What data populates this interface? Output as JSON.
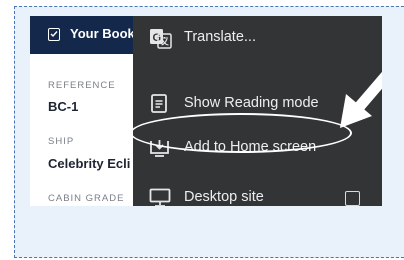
{
  "header": {
    "title": "Your Book",
    "icon": "calendar-check-icon",
    "background": "#14284b"
  },
  "fields": [
    {
      "label": "REFERENCE",
      "value": "BC-1"
    },
    {
      "label": "SHIP",
      "value": "Celebrity Ecli"
    },
    {
      "label": "CABIN GRADE",
      "value": ""
    }
  ],
  "menu": {
    "background": "#333436",
    "items": [
      {
        "label": "Translate...",
        "icon": "google-translate-icon"
      },
      {
        "label": "Show Reading mode",
        "icon": "reading-mode-icon"
      },
      {
        "label": "Add to Home screen",
        "icon": "add-to-home-screen-icon",
        "highlighted": true
      },
      {
        "label": "Desktop site",
        "icon": "desktop-icon",
        "checkbox": false
      }
    ]
  },
  "annotation": {
    "arrow_color": "#ffffff",
    "ellipse_color": "#ffffff"
  },
  "frame_background": "#e9f2fb"
}
